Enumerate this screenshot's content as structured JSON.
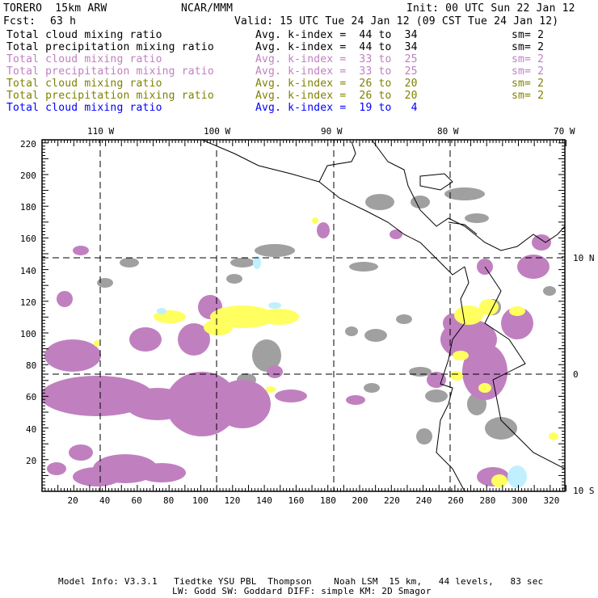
{
  "header": {
    "model": "TORERO  15km ARW",
    "org": "NCAR/MMM",
    "init": "Init: 00 UTC Sun 22 Jan 12",
    "fcst_label": "Fcst:",
    "fcst_value": "63 h",
    "valid": "Valid: 15 UTC Tue 24 Jan 12 (09 CST Tue 24 Jan 12)"
  },
  "legend": [
    {
      "field": "Total cloud mixing ratio",
      "range": "Avg. k-index =  44 to  34",
      "sm": "sm= 2",
      "color": "#000000"
    },
    {
      "field": "Total precipitation mixing ratio",
      "range": "Avg. k-index =  44 to  34",
      "sm": "sm= 2",
      "color": "#000000"
    },
    {
      "field": "Total cloud mixing ratio",
      "range": "Avg. k-index =  33 to  25",
      "sm": "sm= 2",
      "color": "#c080c0"
    },
    {
      "field": "Total precipitation mixing ratio",
      "range": "Avg. k-index =  33 to  25",
      "sm": "sm= 2",
      "color": "#c080c0"
    },
    {
      "field": "Total cloud mixing ratio",
      "range": "Avg. k-index =  26 to  20",
      "sm": "sm= 2",
      "color": "#808000"
    },
    {
      "field": "Total precipitation mixing ratio",
      "range": "Avg. k-index =  26 to  20",
      "sm": "sm= 2",
      "color": "#808000"
    },
    {
      "field": "Total cloud mixing ratio",
      "range": "Avg. k-index =  19 to   4",
      "sm": "",
      "color": "#0000ff"
    }
  ],
  "axes": {
    "x_ticks": [
      "20",
      "40",
      "60",
      "80",
      "100",
      "120",
      "140",
      "160",
      "180",
      "200",
      "220",
      "240",
      "260",
      "280",
      "300",
      "320"
    ],
    "y_ticks": [
      "20",
      "40",
      "60",
      "80",
      "100",
      "120",
      "140",
      "160",
      "180",
      "200",
      "220"
    ],
    "lon_labels": [
      "110 W",
      "100 W",
      "90 W",
      "80 W",
      "70 W"
    ],
    "lat_labels": [
      "10 N",
      "0",
      "10 S"
    ]
  },
  "footer": {
    "line1": "Model Info: V3.3.1   Tiedtke YSU PBL  Thompson    Noah LSM  15 km,   44 levels,   83 sec",
    "line2": "LW: Godd SW: Goddard DIFF: simple KM: 2D Smagor"
  },
  "colors": {
    "gray": "#a0a0a0",
    "purple": "#c080c0",
    "yellow": "#ffff60",
    "lightblue": "#c0f0ff"
  }
}
